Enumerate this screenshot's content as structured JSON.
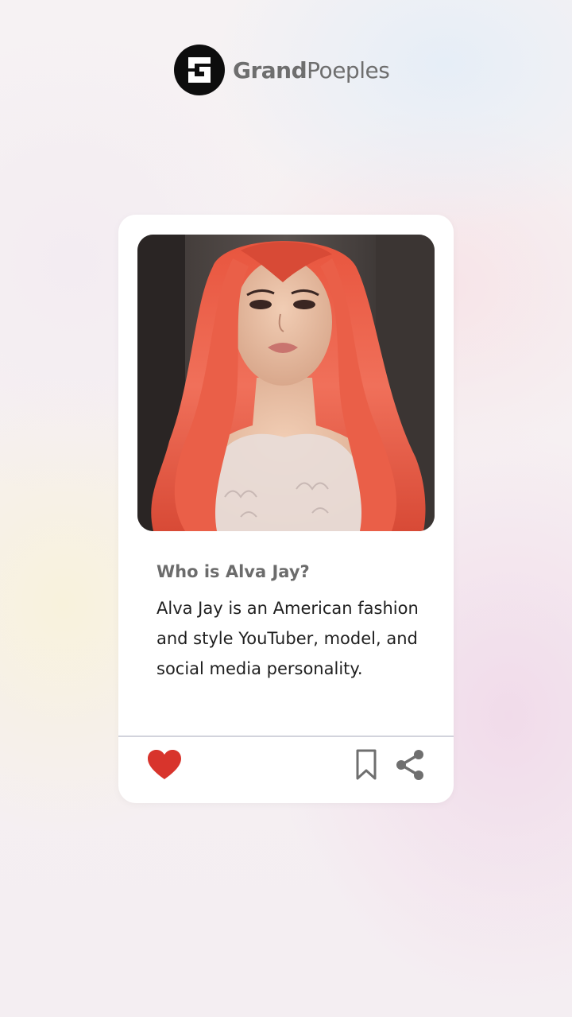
{
  "brand": {
    "name_bold": "Grand",
    "name_regular": "Poeples",
    "logo_icon": "g-logo-icon"
  },
  "card": {
    "photo_alt": "Alva Jay",
    "question": "Who is Alva Jay?",
    "description": "Alva Jay is an American fashion and style YouTuber, model, and social media personality."
  },
  "actions": {
    "like_icon": "heart-icon",
    "save_icon": "bookmark-icon",
    "share_icon": "share-icon",
    "like_color": "#d8342c",
    "icon_color": "#6f6f6f"
  }
}
